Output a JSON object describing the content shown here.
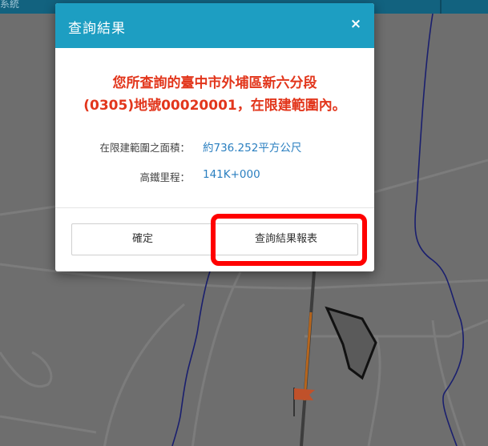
{
  "header": {
    "title_fragment": "系統"
  },
  "dialog": {
    "title": "查詢結果",
    "close_icon": "close-icon",
    "close_glyph": "×",
    "result_line1": "您所查詢的臺中市外埔區新六分段",
    "result_line2": "(0305)地號00020001，在限建範圍內。",
    "area_label": "在限建範圍之面積：",
    "area_value": "約736.252平方公尺",
    "mileage_label": "高鐵里程：",
    "mileage_value": "141K+000",
    "confirm_label": "確定",
    "report_label": "查詢結果報表"
  },
  "colors": {
    "header_bg": "#1d9ec2",
    "result_text": "#e2361c",
    "value_text": "#2a7fc0",
    "highlight": "#ff0000",
    "map_bg": "#6e6e6e",
    "boundary_line": "#1a1f6e",
    "rail_line": "#b5651d",
    "flag": "#c0512a"
  },
  "map": {
    "icons": [
      "flag-marker-icon"
    ]
  }
}
